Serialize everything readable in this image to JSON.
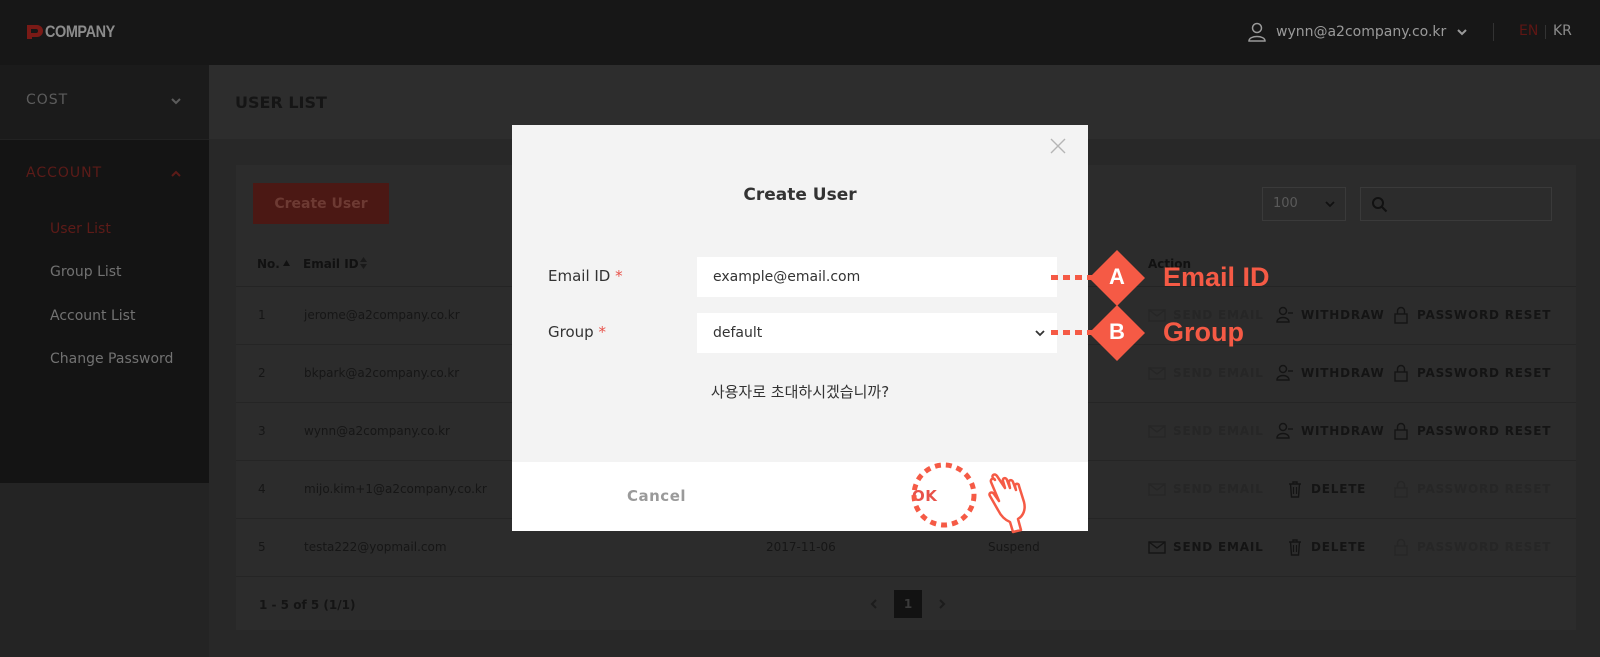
{
  "header": {
    "logo_text": "COMPANY",
    "user_email": "wynn@a2company.co.kr",
    "lang_en": "EN",
    "lang_kr": "KR"
  },
  "sidebar": {
    "cost_label": "COST",
    "account_label": "ACCOUNT",
    "items": [
      {
        "label": "User List",
        "active": true
      },
      {
        "label": "Group List",
        "active": false
      },
      {
        "label": "Account List",
        "active": false
      },
      {
        "label": "Change Password",
        "active": false
      }
    ]
  },
  "page": {
    "title": "USER LIST",
    "create_button": "Create User",
    "page_size": "100",
    "search_placeholder": ""
  },
  "table": {
    "columns": {
      "no": "No.",
      "email": "Email ID",
      "action": "Action"
    },
    "actions": {
      "send_email": "SEND EMAIL",
      "withdraw": "WITHDRAW",
      "delete": "DELETE",
      "password_reset": "PASSWORD RESET"
    },
    "rows": [
      {
        "no": "1",
        "email": "jerome@a2company.co.kr",
        "date": "",
        "status": ""
      },
      {
        "no": "2",
        "email": "bkpark@a2company.co.kr",
        "date": "",
        "status": ""
      },
      {
        "no": "3",
        "email": "wynn@a2company.co.kr",
        "date": "",
        "status": ""
      },
      {
        "no": "4",
        "email": "mijo.kim+1@a2company.co.kr",
        "date": "",
        "status": ""
      },
      {
        "no": "5",
        "email": "testa222@yopmail.com",
        "date": "2017-11-06",
        "status": "Suspend"
      }
    ],
    "pager_info": "1 - 5 of 5 (1/1)",
    "current_page": "1"
  },
  "modal": {
    "title": "Create User",
    "email_label": "Email ID",
    "email_placeholder": "example@email.com",
    "group_label": "Group",
    "group_value": "default",
    "required_mark": "*",
    "message": "사용자로 초대하시겠습니까?",
    "cancel": "Cancel",
    "ok": "OK"
  },
  "annotations": {
    "a_letter": "A",
    "a_text": "Email ID",
    "b_letter": "B",
    "b_text": "Group"
  },
  "colors": {
    "accent": "#f55a45",
    "brand_red": "#e8524a",
    "dark_bg": "#171717"
  }
}
